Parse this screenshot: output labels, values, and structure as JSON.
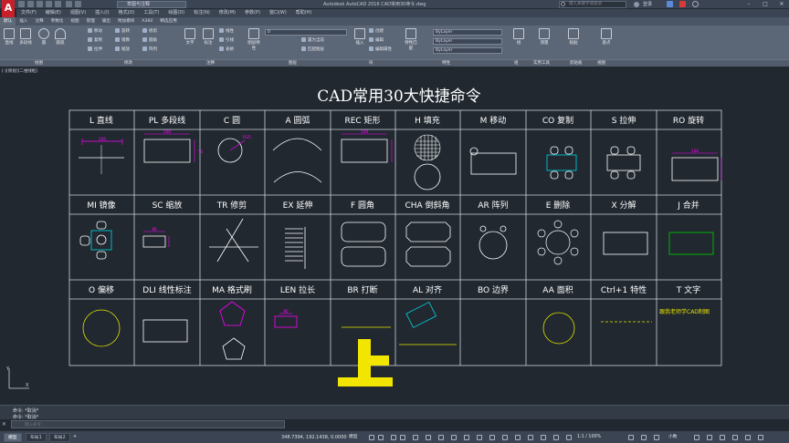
{
  "titlebar": {
    "logo": "A",
    "workspace": "草图与注释",
    "document_title": "Autodesk AutoCAD 2016    CAD常用30命令.dwg",
    "search_placeholder": "键入关键字或短语",
    "login": "登录"
  },
  "menubar": [
    "文件(F)",
    "编辑(E)",
    "视图(V)",
    "插入(I)",
    "格式(O)",
    "工具(T)",
    "绘图(D)",
    "标注(N)",
    "修改(M)",
    "参数(P)",
    "窗口(W)",
    "帮助(H)"
  ],
  "ribbon_tabs": [
    "默认",
    "插入",
    "注释",
    "参数化",
    "视图",
    "管理",
    "输出",
    "附加模块",
    "A360",
    "精选应用"
  ],
  "ribbon": {
    "draw_big": [
      "直线",
      "多段线",
      "圆",
      "圆弧"
    ],
    "modify_small": [
      "移动",
      "旋转",
      "修剪",
      "复制",
      "镜像",
      "圆角",
      "拉伸",
      "缩放",
      "阵列"
    ],
    "annot_big": [
      "文字",
      "标注"
    ],
    "annot_small": [
      "线性",
      "引线",
      "表格"
    ],
    "layer_big": "图层特性",
    "layer_combo": "0",
    "layer_small": [
      "置为当前",
      "匹配图层"
    ],
    "block_big": "插入",
    "block_small": [
      "创建",
      "编辑",
      "编辑属性"
    ],
    "prop_big": "特性匹配",
    "prop_combos": [
      "ByLayer",
      "ByLayer",
      "ByLayer"
    ],
    "group_big": "组",
    "util_big": "测量",
    "clip_big": "粘贴",
    "view_big": "基点"
  },
  "panels": [
    "绘图",
    "修改",
    "注释",
    "图层",
    "块",
    "特性",
    "组",
    "实用工具",
    "剪贴板",
    "视图"
  ],
  "viewport_label": "[-][俯视][二维线框]",
  "drawing": {
    "title": "CAD常用30大快捷命令",
    "rows": [
      [
        "L 直线",
        "PL 多段线",
        "C 圆",
        "A 圆弧",
        "REC 矩形",
        "H 填充",
        "M 移动",
        "CO 复制",
        "S 拉伸",
        "RO 旋转"
      ],
      [
        "MI 镜像",
        "SC 缩放",
        "TR 修剪",
        "EX 延伸",
        "F 圆角",
        "CHA 倒斜角",
        "AR 阵列",
        "E 删除",
        "X 分解",
        "J 合并"
      ],
      [
        "O 偏移",
        "DLI 线性标注",
        "MA 格式刷",
        "LEN 拉长",
        "BR 打断",
        "AL 对齐",
        "BO 边界",
        "AA 面积",
        "Ctrl+1 特性",
        "T 文字"
      ]
    ],
    "dims": {
      "line": "100",
      "pline": "100",
      "circle": "R25",
      "rect": "100",
      "rotate": "100",
      "scale": "80",
      "lengthen": "80",
      "rect_h": "50"
    },
    "sample_text": "跟我老师学CAD制图",
    "colors": {
      "magenta": "#ff00ff",
      "cyan": "#00d6e6",
      "yellow": "#e6e600",
      "green": "#00c000",
      "white": "#ffffff",
      "grid": "#d0d4da"
    }
  },
  "overlay_char": "上",
  "command_line": {
    "history": [
      "命令: *取消*",
      "命令: *取消*"
    ],
    "placeholder": "键入命令"
  },
  "statusbar": {
    "layout_tabs": [
      "模型",
      "布局1",
      "布局2"
    ],
    "coords": "348.7394, 192.1438, 0.0000",
    "model_label": "模型",
    "scale": "1:1 / 100%",
    "units": "小数"
  }
}
